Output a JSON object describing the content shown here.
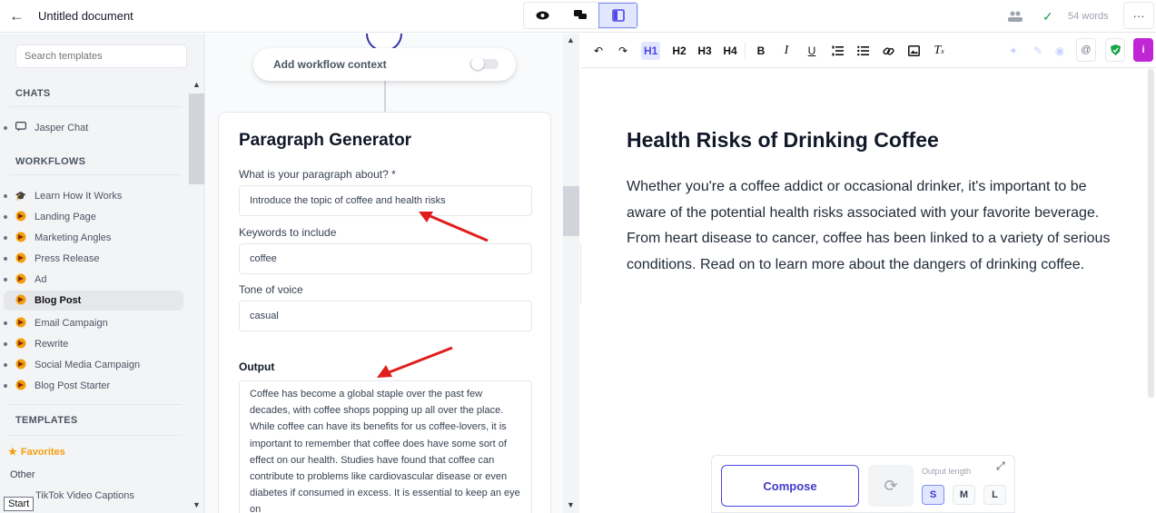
{
  "header": {
    "back_icon": "arrow-left-icon",
    "title": "Untitled document",
    "view_icons": [
      "eye-icon",
      "chat-icon",
      "layout-icon"
    ],
    "word_count": "54 words",
    "more_label": "···"
  },
  "sidebar": {
    "search_placeholder": "Search templates",
    "chats_heading": "CHATS",
    "chats": [
      {
        "label": "Jasper Chat",
        "icon": "chat-bubble-icon"
      }
    ],
    "workflows_heading": "WORKFLOWS",
    "workflows": [
      {
        "label": "Learn How It Works",
        "icon": "graduation-cap-icon"
      },
      {
        "label": "Landing Page",
        "icon": "jasper-logo-icon"
      },
      {
        "label": "Marketing Angles",
        "icon": "jasper-logo-icon"
      },
      {
        "label": "Press Release",
        "icon": "jasper-logo-icon"
      },
      {
        "label": "Ad",
        "icon": "jasper-logo-icon"
      },
      {
        "label": "Blog Post",
        "icon": "jasper-logo-icon",
        "selected": true
      },
      {
        "label": "Email Campaign",
        "icon": "jasper-logo-icon"
      },
      {
        "label": "Rewrite",
        "icon": "jasper-logo-icon"
      },
      {
        "label": "Social Media Campaign",
        "icon": "jasper-logo-icon"
      },
      {
        "label": "Blog Post Starter",
        "icon": "jasper-logo-icon"
      }
    ],
    "templates_heading": "TEMPLATES",
    "favorites_label": "Favorites",
    "other_label": "Other",
    "tiktok_label": "TikTok Video Captions",
    "start_label": "Start"
  },
  "workflow": {
    "context_label": "Add workflow context",
    "title": "Paragraph Generator",
    "about_label": "What is your paragraph about? *",
    "about_value": "Introduce the topic of coffee and health risks",
    "keywords_label": "Keywords to include",
    "keywords_value": "coffee",
    "tone_label": "Tone of voice",
    "tone_value": "casual",
    "output_label": "Output",
    "output_text": "Coffee has become a global staple over the past few decades, with coffee shops popping up all over the place. While coffee can have its benefits for us coffee-lovers, it is important to remember that coffee does have some sort of effect on our health. Studies have found that coffee can contribute to problems like cardiovascular disease or even diabetes if consumed in excess. It is essential to keep an eye on"
  },
  "toolbar": {
    "h1": "H1",
    "h2": "H2",
    "h3": "H3",
    "h4": "H4",
    "bold": "B",
    "italic": "I",
    "underline": "U"
  },
  "editor": {
    "title": "Health Risks of Drinking Coffee",
    "body": "Whether you're a coffee addict or occasional drinker, it's important to be aware of the potential health risks associated with your favorite beverage. From heart disease to cancer, coffee has been linked to a variety of serious conditions. Read on to learn more about the dangers of drinking coffee."
  },
  "compose": {
    "button_label": "Compose",
    "output_length_label": "Output length",
    "sizes": [
      "S",
      "M",
      "L"
    ],
    "selected_size": "S"
  },
  "colors": {
    "accent": "#4f46e5",
    "annotation_arrow": "#e11d1d",
    "shield": "#16a34a",
    "badge": "#c026d3"
  }
}
